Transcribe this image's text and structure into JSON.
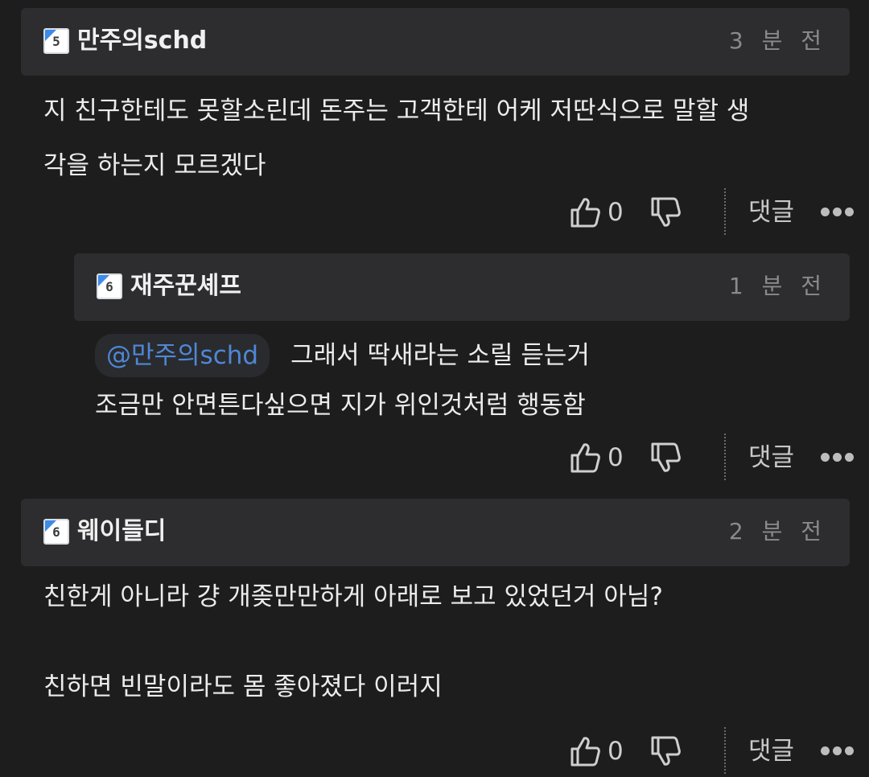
{
  "comments": [
    {
      "level": "5",
      "username": "만주의schd",
      "time": "3 분 전",
      "lines": [
        "지 친구한테도 못할소린데 돈주는 고객한테 어케 저딴식으로 말할 생",
        "각을 하는지 모르겠다"
      ],
      "likes": "0",
      "reply_label": "댓글"
    },
    {
      "level": "6",
      "username": "재주꾼셰프",
      "time": "1 분 전",
      "mention": "@만주의schd",
      "lines": [
        "그래서 딱새라는 소릴 듣는거",
        "조금만 안면튼다싶으면 지가 위인것처럼 행동함"
      ],
      "likes": "0",
      "reply_label": "댓글"
    },
    {
      "level": "6",
      "username": "웨이들디",
      "time": "2 분 전",
      "lines": [
        "친한게 아니라 걍 개좆만만하게 아래로 보고 있었던거 아님?",
        "",
        "친하면 빈말이라도 몸 좋아졌다 이러지"
      ],
      "likes": "0",
      "reply_label": "댓글"
    }
  ],
  "icons": {
    "like": "thumbs-up-outline-icon",
    "dislike": "thumbs-down-outline-icon",
    "more": "more-dots-icon",
    "badge": "level-badge-icon"
  },
  "colors": {
    "background": "#1d1d1e",
    "header": "#2d2d2f",
    "mention": "#4f87d6",
    "badge_accent": "#3d8be8"
  }
}
